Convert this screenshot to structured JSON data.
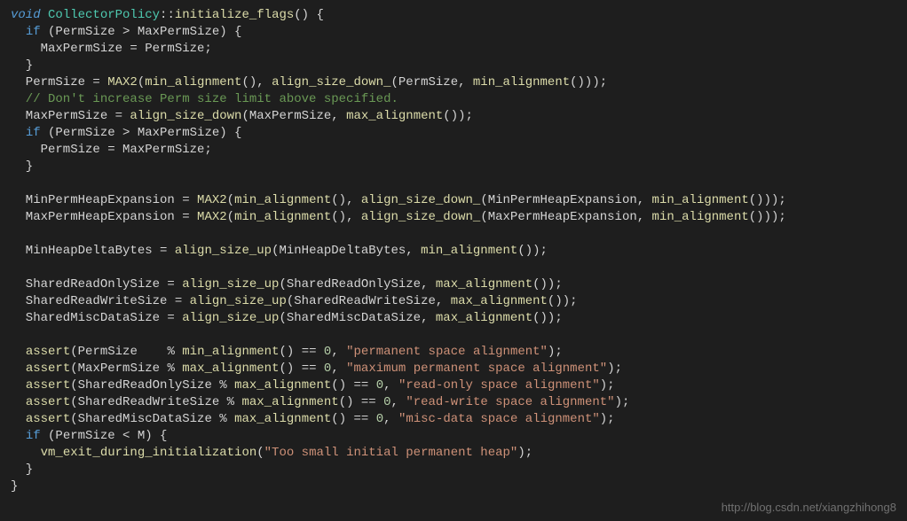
{
  "code": {
    "l1": {
      "kw": "void",
      "cls": "CollectorPolicy",
      "dcolon": "::",
      "fn": "initialize_flags",
      "parens": "() {",
      "key": "void"
    },
    "l2": {
      "kw": "if",
      "cond": " (PermSize > MaxPermSize) {"
    },
    "l3": {
      "text": "    MaxPermSize = PermSize;"
    },
    "l4": {
      "text": "  }"
    },
    "l5": {
      "a": "  PermSize = ",
      "fn": "MAX2",
      "b": "(",
      "fn2": "min_alignment",
      "c": "(), ",
      "fn3": "align_size_down_",
      "d": "(PermSize, ",
      "fn4": "min_alignment",
      "e": "()));"
    },
    "l6": {
      "comment": "  // Don't increase Perm size limit above specified."
    },
    "l7": {
      "a": "  MaxPermSize = ",
      "fn": "align_size_down",
      "b": "(MaxPermSize, ",
      "fn2": "max_alignment",
      "c": "());"
    },
    "l8": {
      "kw": "if",
      "cond": " (PermSize > MaxPermSize) {"
    },
    "l9": {
      "text": "    PermSize = MaxPermSize;"
    },
    "l10": {
      "text": "  }"
    },
    "l11": {
      "text": ""
    },
    "l12": {
      "a": "  MinPermHeapExpansion = ",
      "fn": "MAX2",
      "b": "(",
      "fn2": "min_alignment",
      "c": "(), ",
      "fn3": "align_size_down_",
      "d": "(MinPermHeapExpansion, ",
      "fn4": "min_alignment",
      "e": "()));"
    },
    "l13": {
      "a": "  MaxPermHeapExpansion = ",
      "fn": "MAX2",
      "b": "(",
      "fn2": "min_alignment",
      "c": "(), ",
      "fn3": "align_size_down_",
      "d": "(MaxPermHeapExpansion, ",
      "fn4": "min_alignment",
      "e": "()));"
    },
    "l14": {
      "text": ""
    },
    "l15": {
      "a": "  MinHeapDeltaBytes = ",
      "fn": "align_size_up",
      "b": "(MinHeapDeltaBytes, ",
      "fn2": "min_alignment",
      "c": "());"
    },
    "l16": {
      "text": ""
    },
    "l17": {
      "a": "  SharedReadOnlySize = ",
      "fn": "align_size_up",
      "b": "(SharedReadOnlySize, ",
      "fn2": "max_alignment",
      "c": "());"
    },
    "l18": {
      "a": "  SharedReadWriteSize = ",
      "fn": "align_size_up",
      "b": "(SharedReadWriteSize, ",
      "fn2": "max_alignment",
      "c": "());"
    },
    "l19": {
      "a": "  SharedMiscDataSize = ",
      "fn": "align_size_up",
      "b": "(SharedMiscDataSize, ",
      "fn2": "max_alignment",
      "c": "());"
    },
    "l20": {
      "text": ""
    },
    "l21": {
      "fn": "assert",
      "a": "(PermSize    % ",
      "fn2": "min_alignment",
      "b": "() == ",
      "num": "0",
      "c": ", ",
      "str": "\"permanent space alignment\"",
      "d": ");"
    },
    "l22": {
      "fn": "assert",
      "a": "(MaxPermSize % ",
      "fn2": "max_alignment",
      "b": "() == ",
      "num": "0",
      "c": ", ",
      "str": "\"maximum permanent space alignment\"",
      "d": ");"
    },
    "l23": {
      "fn": "assert",
      "a": "(SharedReadOnlySize % ",
      "fn2": "max_alignment",
      "b": "() == ",
      "num": "0",
      "c": ", ",
      "str": "\"read-only space alignment\"",
      "d": ");"
    },
    "l24": {
      "fn": "assert",
      "a": "(SharedReadWriteSize % ",
      "fn2": "max_alignment",
      "b": "() == ",
      "num": "0",
      "c": ", ",
      "str": "\"read-write space alignment\"",
      "d": ");"
    },
    "l25": {
      "fn": "assert",
      "a": "(SharedMiscDataSize % ",
      "fn2": "max_alignment",
      "b": "() == ",
      "num": "0",
      "c": ", ",
      "str": "\"misc-data space alignment\"",
      "d": ");"
    },
    "l26": {
      "kw": "if",
      "cond": " (PermSize < M) {"
    },
    "l27": {
      "fn": "vm_exit_during_initialization",
      "a": "(",
      "str": "\"Too small initial permanent heap\"",
      "b": ");"
    },
    "l28": {
      "text": "  }"
    },
    "l29": {
      "text": "}"
    }
  },
  "watermark": "http://blog.csdn.net/xiangzhihong8"
}
